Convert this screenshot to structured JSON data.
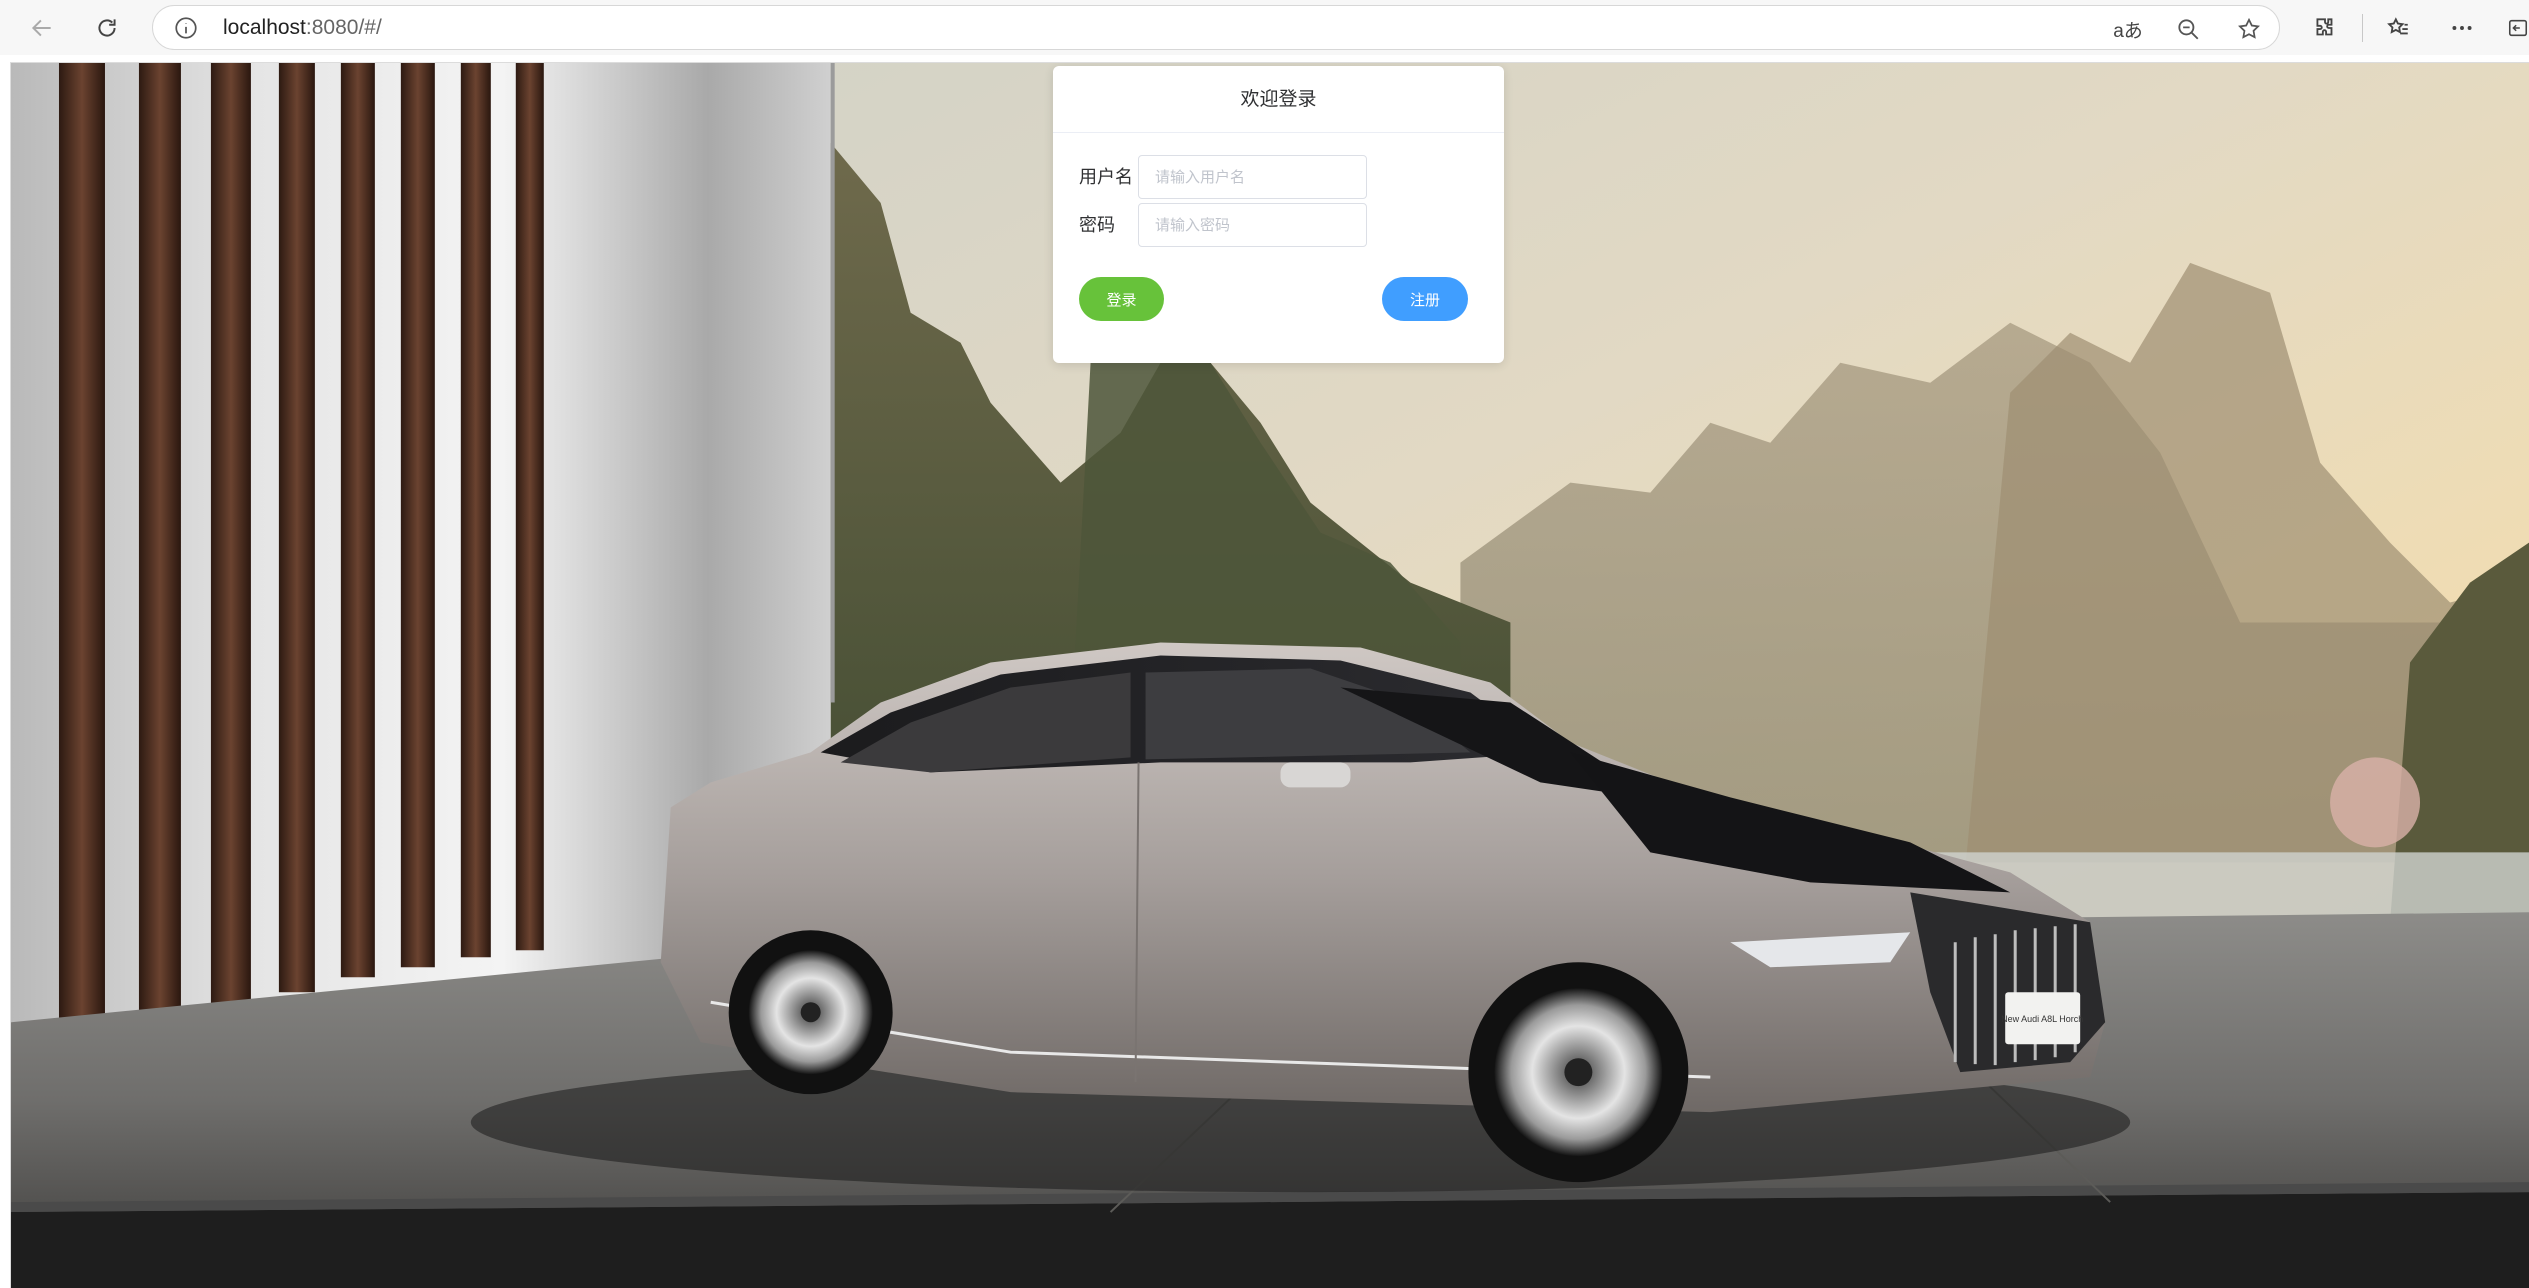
{
  "browser": {
    "url_host": "localhost",
    "url_rest": ":8080/#/",
    "translate_label": "aあ"
  },
  "login": {
    "title": "欢迎登录",
    "username_label": "用户名",
    "username_placeholder": "请输入用户名",
    "username_value": "",
    "password_label": "密码",
    "password_placeholder": "请输入密码",
    "password_value": "",
    "login_button": "登录",
    "register_button": "注册"
  },
  "background": {
    "plate_text": "New Audi A8L Horch"
  }
}
